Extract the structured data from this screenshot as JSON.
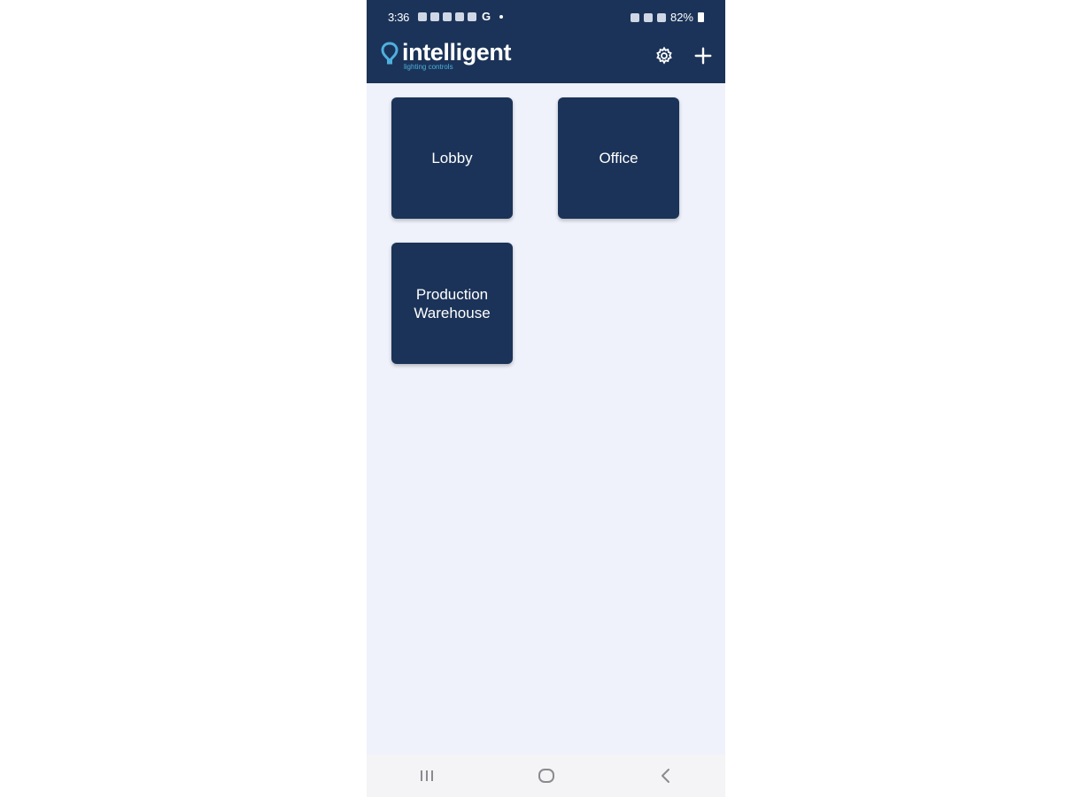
{
  "status_bar": {
    "time": "3:36",
    "battery": "82%",
    "notification_icons": [
      "cloud-icon",
      "message-icon",
      "pay-icon",
      "fan-icon",
      "wifi-calling-icon"
    ],
    "notification_google": "G",
    "system_icons": [
      "battery-saver-icon",
      "wifi-icon",
      "signal-icon",
      "battery-icon"
    ]
  },
  "header": {
    "brand_name": "intelligent",
    "brand_tagline": "lighting controls",
    "settings_icon": "gear-icon",
    "add_icon": "plus-icon",
    "background_color": "#1b3358",
    "accent_color": "#4fb0dd"
  },
  "locations": [
    {
      "label": "Lobby"
    },
    {
      "label": "Office"
    },
    {
      "label": "Production\nWarehouse"
    }
  ],
  "navigation_bar": {
    "recents_icon": "recents-icon",
    "home_icon": "home-icon",
    "back_icon": "back-icon"
  }
}
